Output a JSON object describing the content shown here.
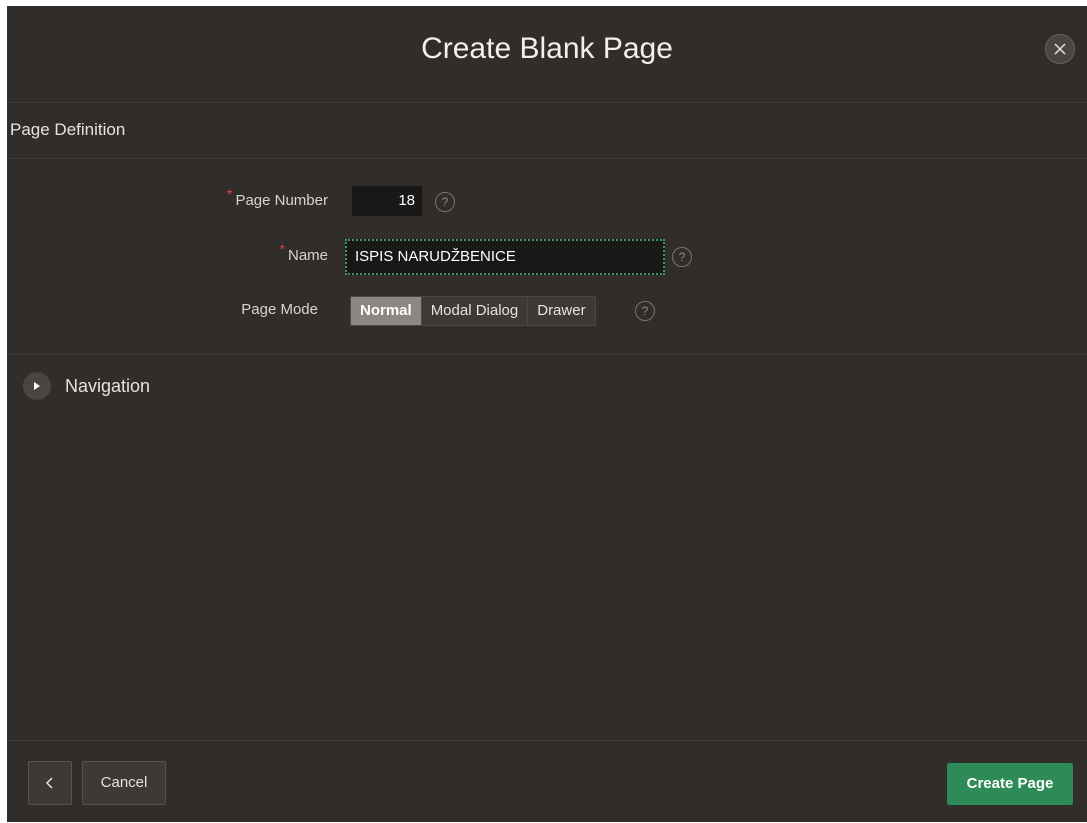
{
  "dialog": {
    "title": "Create Blank Page",
    "close_icon": "close-icon"
  },
  "section": {
    "title": "Page Definition"
  },
  "fields": {
    "page_number": {
      "label": "Page Number",
      "required_mark": "*",
      "value": "18"
    },
    "name": {
      "label": "Name",
      "required_mark": "*",
      "value": "ISPIS NARUDŽBENICE"
    },
    "page_mode": {
      "label": "Page Mode",
      "options": [
        "Normal",
        "Modal Dialog",
        "Drawer"
      ],
      "selected": "Normal"
    },
    "help_glyph": "?"
  },
  "navigation": {
    "label": "Navigation",
    "icon": "expand-arrow-icon"
  },
  "footer": {
    "back_icon": "chevron-left-icon",
    "cancel_label": "Cancel",
    "create_label": "Create Page"
  },
  "colors": {
    "background": "#312d2a",
    "primary_button": "#2e8b57",
    "required": "#e0433a",
    "focus_outline": "#3a9a62"
  }
}
